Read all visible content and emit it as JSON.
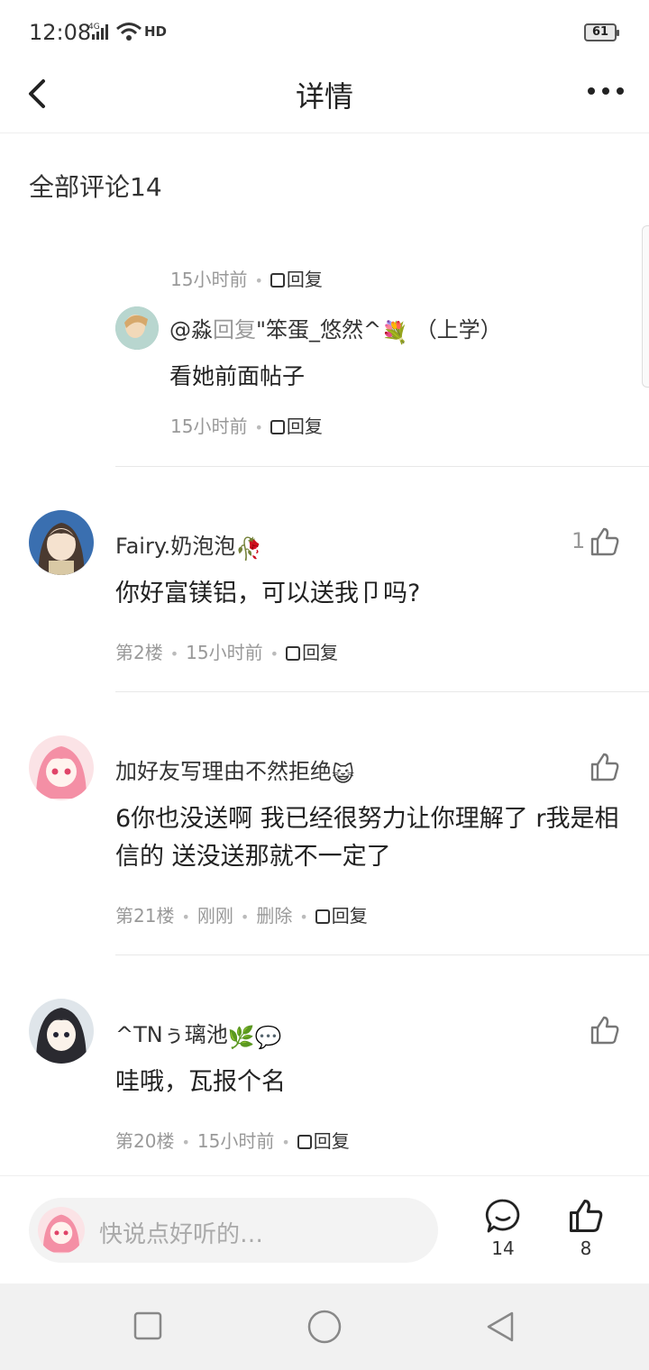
{
  "status_bar": {
    "time": "12:08",
    "network": "4G",
    "hd": "HD",
    "battery": "61"
  },
  "nav": {
    "title": "详情"
  },
  "section": {
    "title": "全部评论14"
  },
  "partial_reply": {
    "time": "15小时前",
    "reply": "回复"
  },
  "sub_reply": {
    "user": "@淼",
    "reply_word": "回复",
    "target": "\"笨蛋_悠然^",
    "emoji": "💐",
    "suffix": "（上学）",
    "text": "看她前面帖子",
    "time": "15小时前",
    "reply": "回复"
  },
  "comments": [
    {
      "username": "Fairy.奶泡泡",
      "emoji": "🥀",
      "text": "你好富镁铝，可以送我卩吗?",
      "floor": "第2楼",
      "time": "15小时前",
      "reply": "回复",
      "likes": "1"
    },
    {
      "username": "加好友写理由不然拒绝",
      "emoji": "😺",
      "text": "6你也没送啊 我已经很努力让你理解了 r我是相信的 送没送那就不一定了",
      "floor": "第21楼",
      "time": "刚刚",
      "delete": "删除",
      "reply": "回复",
      "likes": ""
    },
    {
      "username": "^TNぅ璃池",
      "emoji": "🌿💬",
      "text": "哇哦，瓦报个名",
      "floor": "第20楼",
      "time": "15小时前",
      "reply": "回复",
      "likes": ""
    }
  ],
  "bottom_bar": {
    "placeholder": "快说点好听的…",
    "comment_count": "14",
    "like_count": "8"
  },
  "icons": {
    "back": "chevron-left-icon",
    "more": "more-dots-icon",
    "like": "thumbs-up-icon",
    "comment": "comment-bubble-icon",
    "square": "recent-apps-icon",
    "circle": "home-icon",
    "triangle": "back-triangle-icon"
  },
  "colors": {
    "text": "#222222",
    "secondary": "#999999",
    "divider": "#e8e8e8",
    "nav_bg": "#f1f1f1"
  }
}
